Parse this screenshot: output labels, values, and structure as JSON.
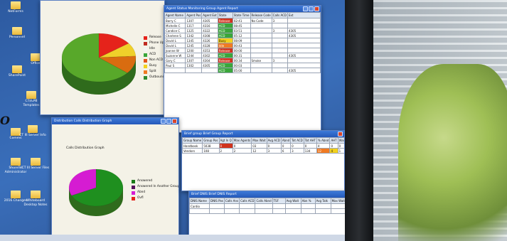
{
  "desktop_icons": [
    {
      "label": "NetForms"
    },
    {
      "label": "Personnel"
    },
    {
      "label": "Office"
    },
    {
      "label": "SharePoint"
    },
    {
      "label": "CTI/LPB Templates"
    },
    {
      "label": "Comms"
    },
    {
      "label": "CT III Server Info"
    },
    {
      "label": "ShoreTel Administrator"
    },
    {
      "label": "CT III Server Files"
    },
    {
      "label": "2016 Changes"
    },
    {
      "label": "Whiteboard Desktop Notes"
    }
  ],
  "window_pie_top": {
    "title": "",
    "chart_data": {
      "type": "pie",
      "values": [
        15,
        9,
        12,
        64
      ],
      "colors": [
        "#e5231b",
        "#efd02a",
        "#d96c10",
        "#58a82a"
      ]
    },
    "legend": [
      "Release",
      "Phone Up",
      "Idle",
      "ACD",
      "Non ACD",
      "Busy",
      "Split",
      "Outbound"
    ],
    "legend_colors": [
      "#e5231b",
      "#c02a20",
      "#f3f3f3",
      "#3aa63a",
      "#e3541a",
      "#f3d11c",
      "#f07a22",
      "#2e8a2e"
    ]
  },
  "window_agents": {
    "title": "Agent Status Monitoring Group Agent Report",
    "headers": [
      "Agent Name",
      "Agent Pos",
      "Agent Ext",
      "State",
      "State Time",
      "Release Code",
      "Calls ACD",
      "Ext"
    ],
    "rows": [
      [
        "Barry C",
        "1307",
        "4305",
        "Release",
        "02:41",
        "No Code",
        "3",
        ""
      ],
      [
        "Michelle C",
        "1317",
        "4316",
        "ACD",
        "08:45",
        "",
        "",
        ""
      ],
      [
        "Candice C",
        "1325",
        "4322",
        "ACD",
        "03:51",
        "",
        "3",
        "4305"
      ],
      [
        "Charlene S",
        "1342",
        "4308",
        "ACD",
        "05:12",
        "",
        "",
        "4305"
      ],
      [
        "David L",
        "1345",
        "4326",
        "Busy",
        "08:09",
        "",
        "",
        ""
      ],
      [
        "David L",
        "1245",
        "4328",
        "Idle",
        "00:43",
        "",
        "",
        ""
      ],
      [
        "Joanne W",
        "1200",
        "4353",
        "Release",
        "00:00",
        "",
        "",
        ""
      ],
      [
        "Suzanne W",
        "1244",
        "4302",
        "ACD",
        "00:31",
        "",
        "",
        "4305"
      ],
      [
        "Gary C",
        "1307",
        "4304",
        "Release",
        "00:34",
        "Smoke",
        "3",
        ""
      ],
      [
        "Paul S",
        "1302",
        "4305",
        "ACD",
        "00:03",
        "",
        "",
        ""
      ],
      [
        "",
        "",
        "",
        "ACD",
        "05:00",
        "",
        "",
        "4305"
      ]
    ]
  },
  "window_pie_bottom": {
    "title": "Distribution Calls Distribution Graph",
    "chart_title": "Calls Distribution Graph",
    "chart_data": {
      "type": "pie",
      "values": [
        68,
        32
      ],
      "colors": [
        "#1f8f1f",
        "#d51cd2"
      ]
    },
    "legend": [
      "Answered",
      "Answered In Another Group",
      "Abnd",
      "Ovfl"
    ],
    "legend_colors": [
      "#1a7a1a",
      "#560f5e",
      "#d51cd2",
      "#e5231b"
    ]
  },
  "window_group": {
    "title": "Brief group Brief Group Report",
    "headers": [
      "Group Name",
      "Group Pos",
      "Agt In Q",
      "Max Agents",
      "Max Wait",
      "Avg ACD",
      "Abnd",
      "Tot ACD",
      "Tot AHT",
      "% Abnd",
      "AHT",
      "Wait"
    ],
    "rows": [
      [
        "Handbook",
        "5038",
        "0",
        "0",
        "03",
        "0",
        "0",
        "0",
        "0",
        "4",
        "0",
        "0"
      ],
      [
        "Vendors",
        "108",
        "2",
        "2",
        "12",
        "3",
        "6",
        "3",
        "134",
        "12",
        "4",
        "1"
      ]
    ]
  },
  "window_dnis": {
    "title": "Brief DNIS Brief DNIS Report",
    "headers": [
      "DNIS Name",
      "DNIS Pos",
      "Calls Ans",
      "Calls ACD",
      "Calls Abnd",
      "TSF",
      "Avg Wait",
      "Abn %",
      "Avg Talk",
      "Max Wait"
    ],
    "rows": [
      [
        "Cardio",
        "",
        "",
        "",
        "",
        "",
        "",
        "",
        "",
        ""
      ],
      [
        "",
        "",
        "",
        "",
        "",
        "",
        "",
        "",
        "",
        ""
      ]
    ]
  },
  "overlay_text": "O"
}
